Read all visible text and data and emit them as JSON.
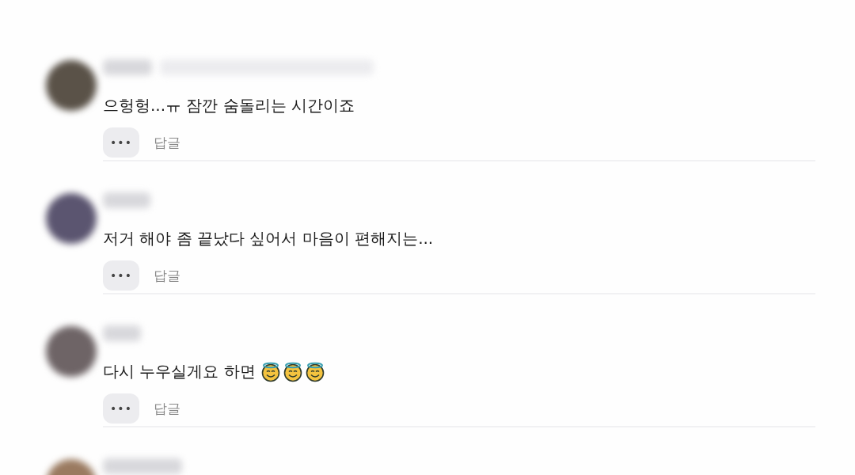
{
  "comments": [
    {
      "text": "으헝헝...ㅠ 잠깐 숨돌리는 시간이죠",
      "more_label": "•••",
      "reply_label": "답글"
    },
    {
      "text": "저거 해야 좀 끝났다 싶어서 마음이 편해지는...",
      "more_label": "•••",
      "reply_label": "답글"
    },
    {
      "text": "다시 누우실게요 하면",
      "emojis": [
        {
          "kind": "halo"
        },
        {
          "kind": "halo"
        },
        {
          "kind": "halo"
        }
      ],
      "more_label": "•••",
      "reply_label": "답글"
    }
  ],
  "partial_comment": {
    "visible": true
  }
}
